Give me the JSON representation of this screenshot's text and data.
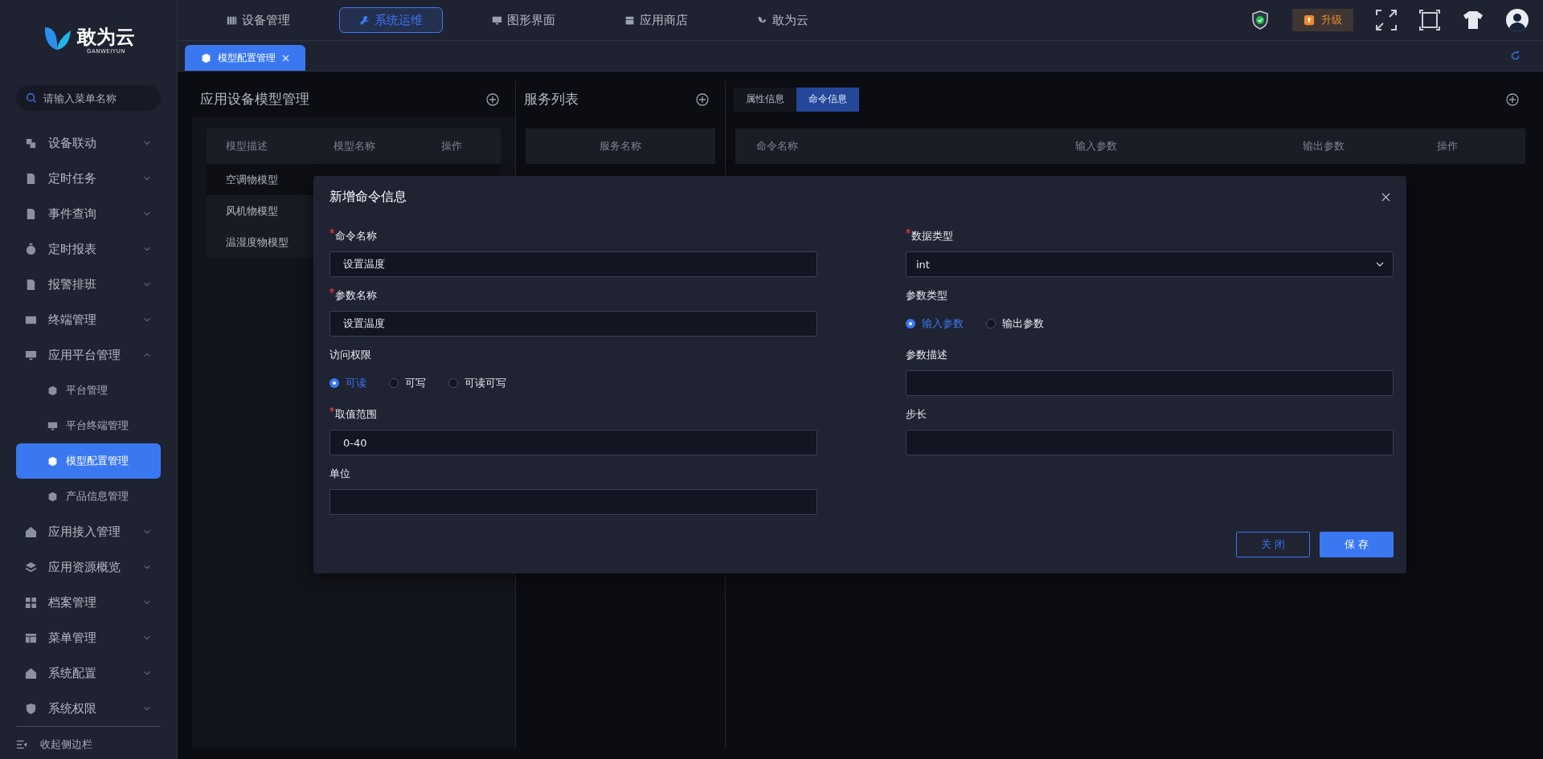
{
  "logo": {
    "name": "敢为云",
    "subtitle": "GANWEIYUN"
  },
  "search": {
    "placeholder": "请输入菜单名称"
  },
  "sidebar": {
    "items": [
      {
        "label": "设备联动",
        "expanded": false
      },
      {
        "label": "定时任务",
        "expanded": false
      },
      {
        "label": "事件查询",
        "expanded": false
      },
      {
        "label": "定时报表",
        "expanded": false
      },
      {
        "label": "报警排班",
        "expanded": false
      },
      {
        "label": "终端管理",
        "expanded": false
      },
      {
        "label": "应用平台管理",
        "expanded": true,
        "children": [
          {
            "label": "平台管理",
            "selected": false
          },
          {
            "label": "平台终端管理",
            "selected": false
          },
          {
            "label": "模型配置管理",
            "selected": true
          },
          {
            "label": "产品信息管理",
            "selected": false
          }
        ]
      },
      {
        "label": "应用接入管理",
        "expanded": false
      },
      {
        "label": "应用资源概览",
        "expanded": false
      },
      {
        "label": "档案管理",
        "expanded": false
      },
      {
        "label": "菜单管理",
        "expanded": false
      },
      {
        "label": "系统配置",
        "expanded": false
      },
      {
        "label": "系统权限",
        "expanded": false
      }
    ],
    "collapse": "收起侧边栏"
  },
  "top_nav": [
    {
      "label": "设备管理",
      "selected": false
    },
    {
      "label": "系统运维",
      "selected": true
    },
    {
      "label": "图形界面",
      "selected": false
    },
    {
      "label": "应用商店",
      "selected": false
    },
    {
      "label": "敢为云",
      "selected": false
    }
  ],
  "upgrade": "升级",
  "page_tabs": [
    {
      "label": "模型配置管理",
      "selected": true
    }
  ],
  "model_panel": {
    "title": "应用设备模型管理",
    "columns": [
      "模型描述",
      "模型名称",
      "操作"
    ],
    "rows": [
      {
        "description": "空调物模型",
        "selected": true
      },
      {
        "description": "风机物模型",
        "selected": false
      },
      {
        "description": "温湿度物模型",
        "selected": false
      }
    ]
  },
  "service_panel": {
    "title": "服务列表",
    "columns": [
      "服务名称"
    ]
  },
  "detail_panel": {
    "tabs": [
      {
        "label": "属性信息",
        "selected": false
      },
      {
        "label": "命令信息",
        "selected": true
      }
    ],
    "columns": [
      "命令名称",
      "输入参数",
      "输出参数",
      "操作"
    ]
  },
  "dialog": {
    "title": "新增命令信息",
    "left_fields": [
      {
        "kind": "input",
        "label": "命令名称",
        "required": true,
        "value": "设置温度"
      },
      {
        "kind": "input",
        "label": "参数名称",
        "required": true,
        "value": "设置温度"
      },
      {
        "kind": "radio",
        "label": "访问权限",
        "required": false,
        "options": [
          {
            "label": "可读",
            "selected": true
          },
          {
            "label": "可写",
            "selected": false
          },
          {
            "label": "可读可写",
            "selected": false
          }
        ]
      },
      {
        "kind": "input",
        "label": "取值范围",
        "required": true,
        "value": "0-40"
      },
      {
        "kind": "input",
        "label": "单位",
        "required": false
      }
    ],
    "right_fields": [
      {
        "kind": "select",
        "label": "数据类型",
        "required": true,
        "value": "int"
      },
      {
        "kind": "radio",
        "label": "参数类型",
        "required": false,
        "options": [
          {
            "label": "输入参数",
            "selected": true
          },
          {
            "label": "输出参数",
            "selected": false
          }
        ]
      },
      {
        "kind": "input",
        "label": "参数描述",
        "required": false
      },
      {
        "kind": "input",
        "label": "步长",
        "required": false
      }
    ],
    "buttons": [
      {
        "label": "关 闭",
        "kind": "secondary"
      },
      {
        "label": "保 存",
        "kind": "primary"
      }
    ]
  }
}
